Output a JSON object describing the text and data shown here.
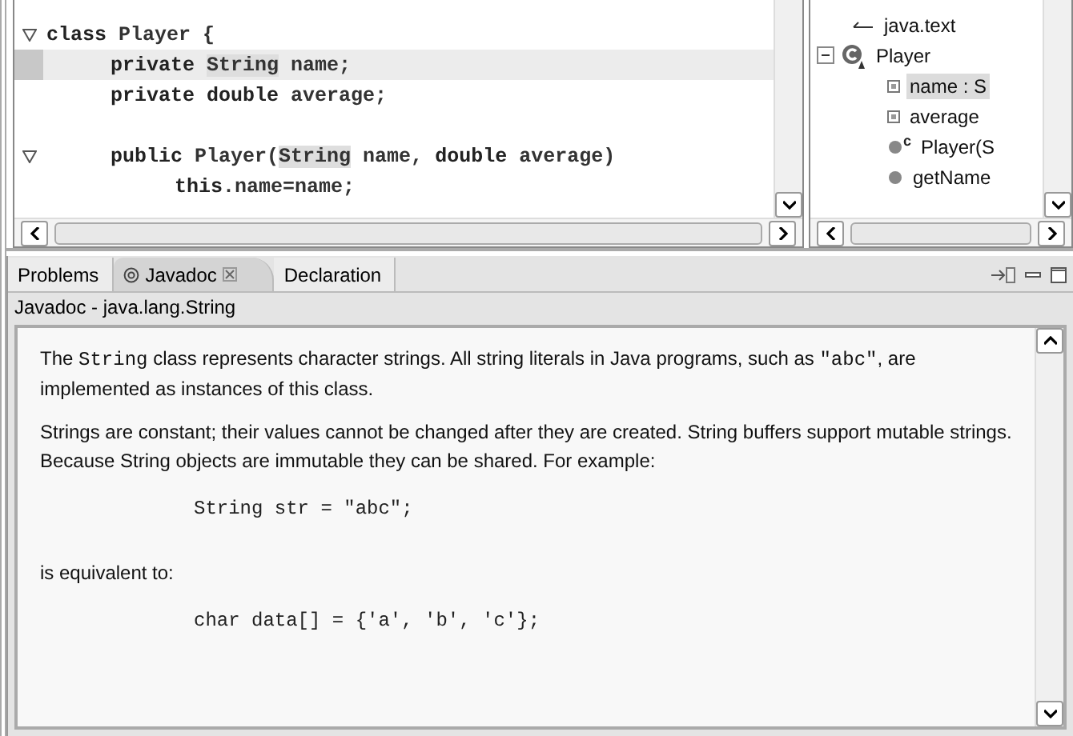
{
  "editor": {
    "lines": [
      {
        "kind": "code",
        "fold": true,
        "current": false,
        "segments": [
          {
            "text": "class",
            "kind": "kw"
          },
          {
            "text": " Player {",
            "kind": "plain"
          }
        ],
        "children": [
          {
            "kind": "code",
            "fold": false,
            "current": true,
            "segments": [
              {
                "text": "private ",
                "kind": "kw"
              },
              {
                "text": "String",
                "kind": "mark"
              },
              {
                "text": " name;",
                "kind": "plain"
              }
            ]
          },
          {
            "kind": "code",
            "fold": false,
            "current": false,
            "segments": [
              {
                "text": "private double",
                "kind": "kw"
              },
              {
                "text": " average;",
                "kind": "plain"
              }
            ]
          },
          {
            "kind": "blank",
            "fold": false,
            "current": false
          },
          {
            "kind": "code",
            "fold": true,
            "current": false,
            "segments": [
              {
                "text": "public",
                "kind": "kw"
              },
              {
                "text": " Player(",
                "kind": "plain"
              },
              {
                "text": "String",
                "kind": "mark"
              },
              {
                "text": " name, ",
                "kind": "plain"
              },
              {
                "text": "double",
                "kind": "kw"
              },
              {
                "text": " average)",
                "kind": "plain"
              }
            ],
            "children": [
              {
                "kind": "code",
                "fold": false,
                "current": false,
                "segments": [
                  {
                    "text": "this",
                    "kind": "kw"
                  },
                  {
                    "text": ".name=name;",
                    "kind": "plain"
                  }
                ]
              }
            ]
          }
        ]
      }
    ]
  },
  "outline": {
    "items": [
      {
        "label": "java.text",
        "kind": "import",
        "selected": false
      },
      {
        "label": "Player",
        "kind": "class",
        "selected": false,
        "expanded": true,
        "children": [
          {
            "label": "name : S",
            "kind": "field",
            "selected": true
          },
          {
            "label": "average",
            "kind": "field",
            "selected": false
          },
          {
            "label": "Player(S",
            "kind": "constructor",
            "badge": "c",
            "selected": false
          },
          {
            "label": "getName",
            "kind": "method",
            "selected": false
          }
        ]
      }
    ]
  },
  "tabs": [
    {
      "label": "Problems",
      "selected": false
    },
    {
      "label": "Javadoc",
      "selected": true
    },
    {
      "label": "Declaration",
      "selected": false
    }
  ],
  "javadoc": {
    "title": "Javadoc - java.lang.String",
    "blocks": [
      {
        "kind": "text",
        "segments": [
          {
            "text": "The ",
            "kind": "plain"
          },
          {
            "text": "String",
            "kind": "code"
          },
          {
            "text": " class represents character strings. All string literals in Java programs, such as ",
            "kind": "plain"
          },
          {
            "text": "\"abc\"",
            "kind": "code"
          },
          {
            "text": ", are implemented as instances of this class.",
            "kind": "plain"
          }
        ]
      },
      {
        "kind": "text",
        "segments": [
          {
            "text": "Strings are constant; their values cannot be changed after they are created. String buffers support mutable strings. Because String objects are immutable they can be shared. For example:",
            "kind": "plain"
          }
        ]
      },
      {
        "kind": "code",
        "segments": [
          {
            "text": "String str = \"abc\";",
            "kind": "plain"
          }
        ]
      },
      {
        "kind": "text",
        "segments": [
          {
            "text": "is equivalent to:",
            "kind": "plain"
          }
        ]
      },
      {
        "kind": "code",
        "segments": [
          {
            "text": "char data[] = {'a', 'b', 'c'};",
            "kind": "plain"
          }
        ]
      }
    ]
  }
}
